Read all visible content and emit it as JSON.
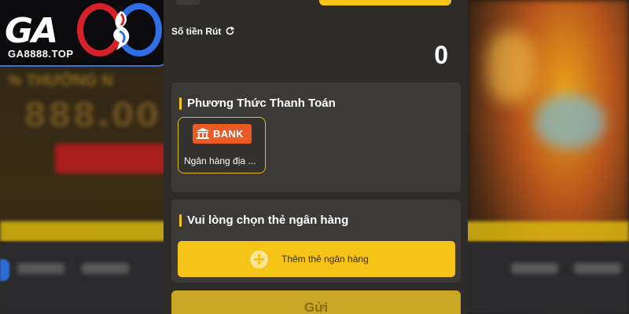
{
  "logo": {
    "brand_left": "GA",
    "url": "GA8888.TOP"
  },
  "background": {
    "promo_small": "% THƯỞNG N",
    "promo_big": "888.00"
  },
  "withdraw": {
    "amount_label": "Số tiền Rút",
    "amount_value": "0",
    "refresh_icon": "refresh-icon"
  },
  "payment_method": {
    "title": "Phương Thức Thanh Toán",
    "options": [
      {
        "badge": "BANK",
        "icon": "bank-building-icon",
        "label": "Ngân hàng địa ..."
      }
    ]
  },
  "bank_card": {
    "title": "Vui lòng chọn thẻ ngân hàng",
    "add_button_label": "Thêm thẻ ngân hàng",
    "add_icon": "plus-circle-icon"
  },
  "submit": {
    "label": "Gửi"
  },
  "colors": {
    "accent": "#f5c416",
    "panel": "#2d2c2a",
    "card": "#3b3a38",
    "bank_badge": "#ec5a24"
  }
}
